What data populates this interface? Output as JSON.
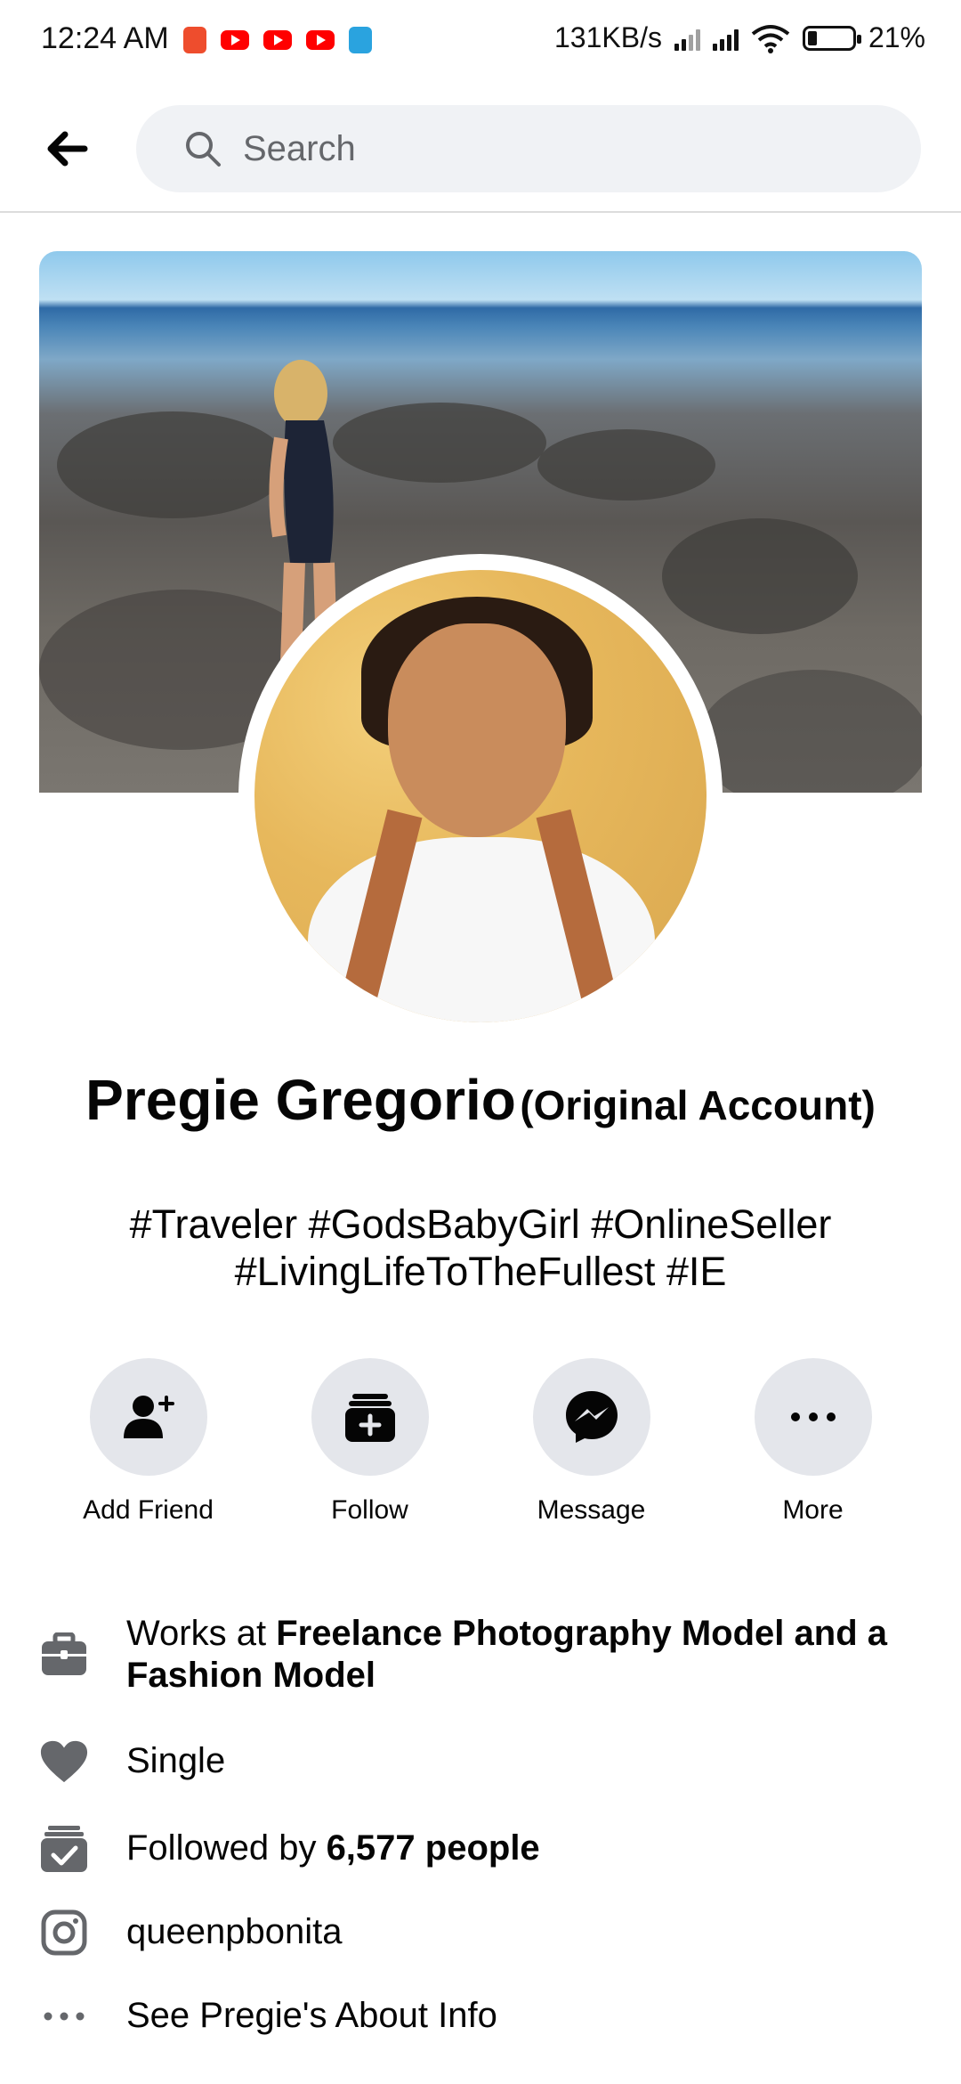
{
  "status_bar": {
    "time": "12:24 AM",
    "network_speed": "131KB/s",
    "battery": "21%",
    "notification_icons": [
      "shopee-icon",
      "youtube-icon",
      "youtube-icon",
      "youtube-icon",
      "telegram-icon"
    ]
  },
  "header": {
    "search_placeholder": "Search"
  },
  "profile": {
    "name": "Pregie Gregorio",
    "name_suffix": "(Original Account)",
    "bio_line1": "#Traveler #GodsBabyGirl #OnlineSeller",
    "bio_line2": "#LivingLifeToTheFullest #IE"
  },
  "actions": {
    "add_friend": "Add Friend",
    "follow": "Follow",
    "message": "Message",
    "more": "More"
  },
  "intro": {
    "work_prefix": "Works at ",
    "work_place": "Freelance Photography Model and a Fashion Model",
    "relationship": "Single",
    "followed_prefix": "Followed by ",
    "followed_count": "6,577 people",
    "instagram": "queenpbonita",
    "about": "See Pregie's About Info"
  },
  "colors": {
    "button_bg": "#e4e6eb",
    "search_bg": "#f0f2f5",
    "icon_gray": "#65676b",
    "text": "#050505"
  }
}
